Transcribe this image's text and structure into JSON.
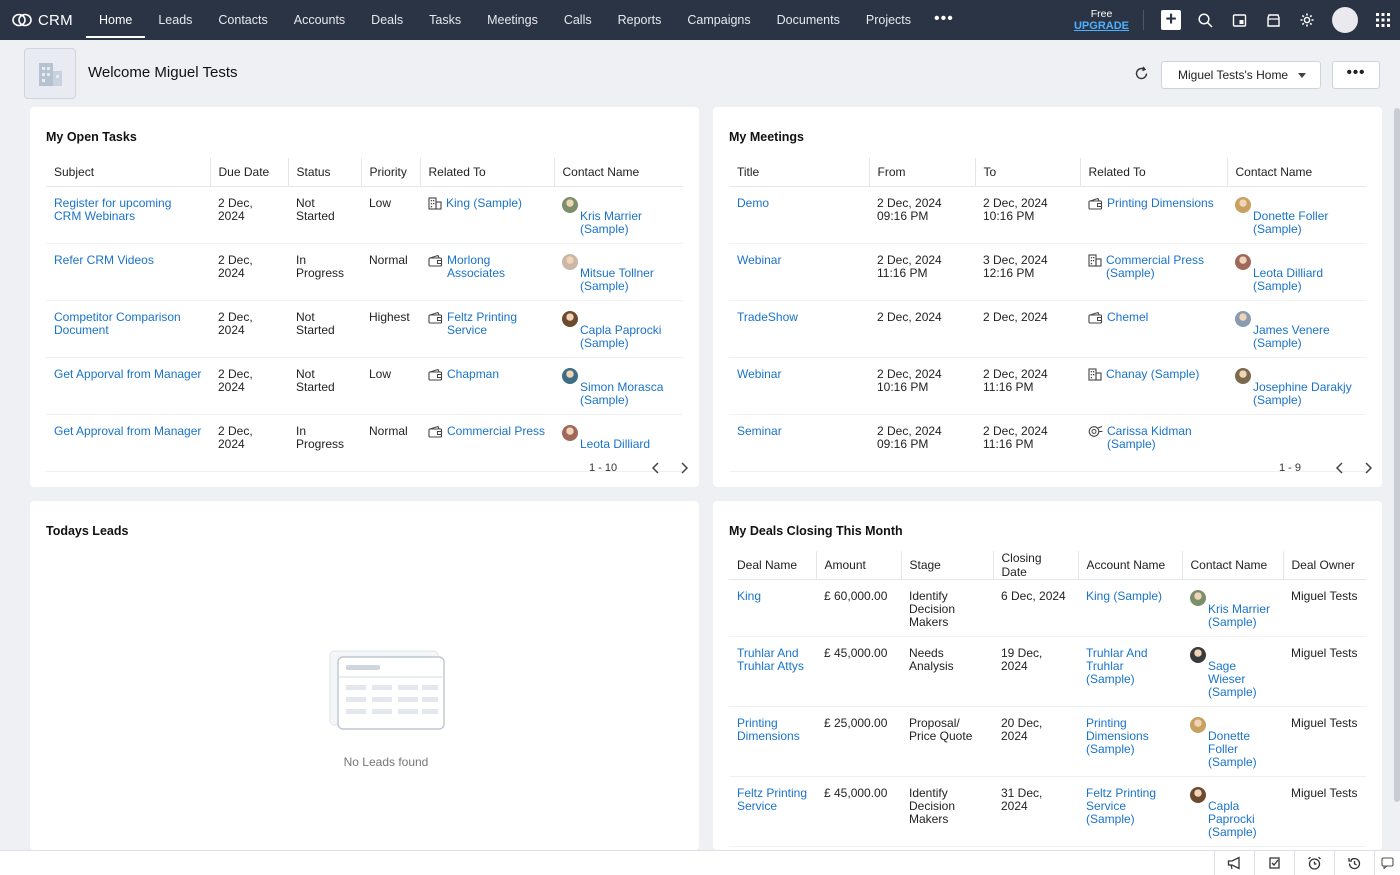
{
  "brand": {
    "name": "CRM"
  },
  "nav": {
    "items": [
      "Home",
      "Leads",
      "Contacts",
      "Accounts",
      "Deals",
      "Tasks",
      "Meetings",
      "Calls",
      "Reports",
      "Campaigns",
      "Documents",
      "Projects"
    ],
    "active": "Home",
    "more": "•••",
    "free_label": "Free",
    "upgrade_label": "UPGRADE"
  },
  "header": {
    "welcome": "Welcome Miguel Tests",
    "home_select": "Miguel Tests's Home",
    "more_label": "•••"
  },
  "tasks": {
    "title": "My Open Tasks",
    "columns": [
      "Subject",
      "Due Date",
      "Status",
      "Priority",
      "Related To",
      "Contact Name"
    ],
    "rows": [
      {
        "subject": "Register for upcoming CRM Webinars",
        "due": "2 Dec, 2024",
        "status": "Not Started",
        "priority": "Low",
        "related": "King (Sample)",
        "related_icon": "building-icon",
        "contact": "Kris Marrier (Sample)",
        "avatar": "#7a8f6a"
      },
      {
        "subject": "Refer CRM Videos",
        "due": "2 Dec, 2024",
        "status": "In Progress",
        "priority": "Normal",
        "related": "Morlong Associates",
        "related_icon": "wallet-icon",
        "contact": "Mitsue Tollner (Sample)",
        "avatar": "#c9b7a6"
      },
      {
        "subject": "Competitor Comparison Document",
        "due": "2 Dec, 2024",
        "status": "Not Started",
        "priority": "Highest",
        "related": "Feltz Printing Service",
        "related_icon": "wallet-icon",
        "contact": "Capla Paprocki (Sample)",
        "avatar": "#6b4a2f"
      },
      {
        "subject": "Get Apporval from Manager",
        "due": "2 Dec, 2024",
        "status": "Not Started",
        "priority": "Low",
        "related": "Chapman",
        "related_icon": "wallet-icon",
        "contact": "Simon Morasca (Sample)",
        "avatar": "#3c6f86"
      },
      {
        "subject": "Get Approval from Manager",
        "due": "2 Dec, 2024",
        "status": "In Progress",
        "priority": "Normal",
        "related": "Commercial Press",
        "related_icon": "wallet-icon",
        "contact": "Leota Dilliard",
        "avatar": "#a0685a"
      }
    ],
    "pager": "1 - 10"
  },
  "meetings": {
    "title": "My Meetings",
    "columns": [
      "Title",
      "From",
      "To",
      "Related To",
      "Contact Name"
    ],
    "rows": [
      {
        "title": "Demo",
        "from": "2 Dec, 2024 09:16 PM",
        "to": "2 Dec, 2024 10:16 PM",
        "related": "Printing Dimensions",
        "related_icon": "wallet-icon",
        "contact": "Donette Foller (Sample)",
        "avatar": "#c8a060"
      },
      {
        "title": "Webinar",
        "from": "2 Dec, 2024 11:16 PM",
        "to": "3 Dec, 2024 12:16 PM",
        "related": "Commercial Press (Sample)",
        "related_icon": "building-icon",
        "contact": "Leota Dilliard (Sample)",
        "avatar": "#a0685a"
      },
      {
        "title": "TradeShow",
        "from": "2 Dec, 2024",
        "to": "2 Dec, 2024",
        "related": "Chemel",
        "related_icon": "wallet-icon",
        "contact": "James Venere (Sample)",
        "avatar": "#8a9bb0"
      },
      {
        "title": "Webinar",
        "from": "2 Dec, 2024 10:16 PM",
        "to": "2 Dec, 2024 11:16 PM",
        "related": "Chanay (Sample)",
        "related_icon": "building-icon",
        "contact": "Josephine Darakjy (Sample)",
        "avatar": "#7c6a4d"
      },
      {
        "title": "Seminar",
        "from": "2 Dec, 2024 09:16 PM",
        "to": "2 Dec, 2024 11:16 PM",
        "related": "Carissa Kidman (Sample)",
        "related_icon": "lead-icon",
        "contact": "",
        "avatar": ""
      }
    ],
    "pager": "1 - 9"
  },
  "leads": {
    "title": "Todays Leads",
    "empty": "No Leads found"
  },
  "deals": {
    "title": "My Deals Closing This Month",
    "columns": [
      "Deal Name",
      "Amount",
      "Stage",
      "Closing Date",
      "Account Name",
      "Contact Name",
      "Deal Owner"
    ],
    "rows": [
      {
        "name": "King",
        "amount": "£ 60,000.00",
        "stage": "Identify Decision Makers",
        "closing": "6 Dec, 2024",
        "account": "King (Sample)",
        "contact": "Kris Marrier (Sample)",
        "avatar": "#7a8f6a",
        "owner": "Miguel Tests"
      },
      {
        "name": "Truhlar And Truhlar Attys",
        "amount": "£ 45,000.00",
        "stage": "Needs Analysis",
        "closing": "19 Dec, 2024",
        "account": "Truhlar And Truhlar (Sample)",
        "contact": "Sage Wieser (Sample)",
        "avatar": "#3b3b3b",
        "owner": "Miguel Tests"
      },
      {
        "name": "Printing Dimensions",
        "amount": "£ 25,000.00",
        "stage": "Proposal/ Price Quote",
        "closing": "20 Dec, 2024",
        "account": "Printing Dimensions (Sample)",
        "contact": "Donette Foller (Sample)",
        "avatar": "#c8a060",
        "owner": "Miguel Tests"
      },
      {
        "name": "Feltz Printing Service",
        "amount": "£ 45,000.00",
        "stage": "Identify Decision Makers",
        "closing": "31 Dec, 2024",
        "account": "Feltz Printing Service (Sample)",
        "contact": "Capla Paprocki (Sample)",
        "avatar": "#6b4a2f",
        "owner": "Miguel Tests"
      }
    ]
  }
}
